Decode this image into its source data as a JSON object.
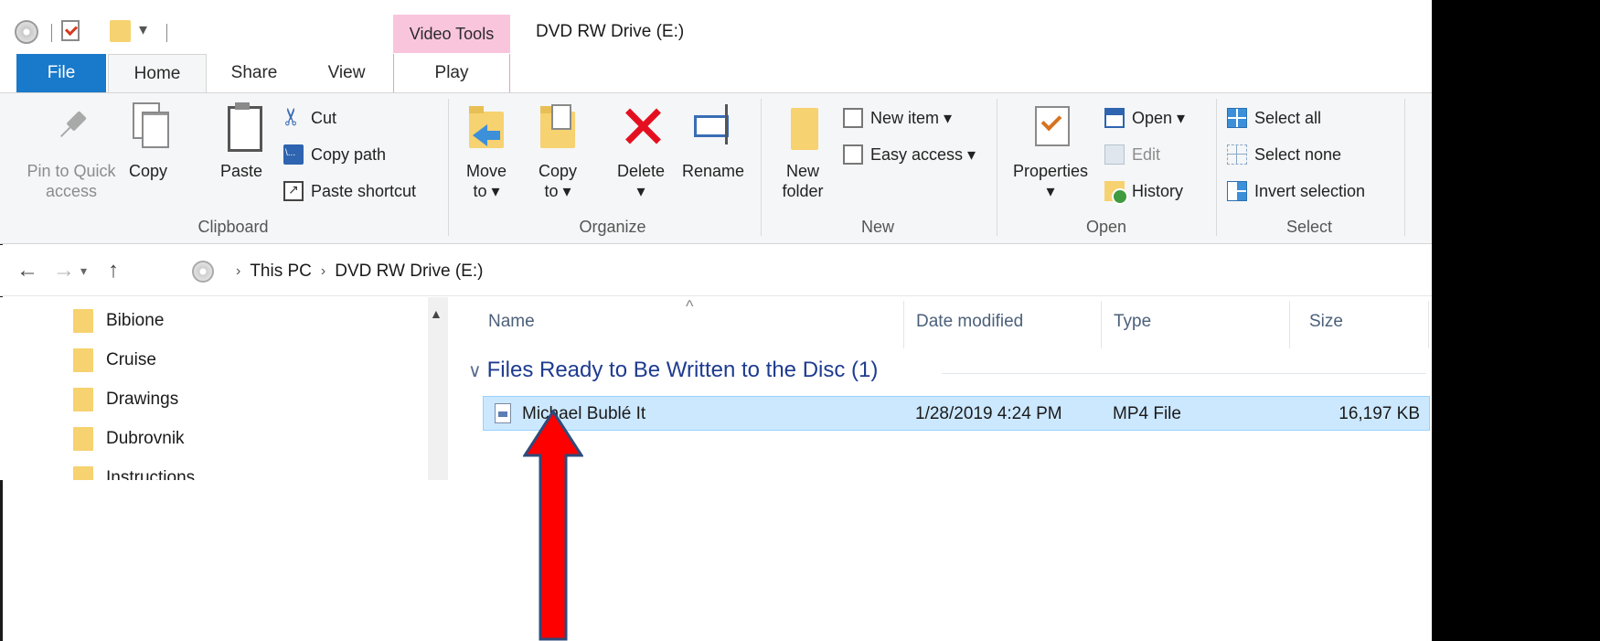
{
  "titlebar": {
    "contextual_tab": "Video Tools",
    "window_title": "DVD RW Drive (E:)"
  },
  "tabs": {
    "file": "File",
    "home": "Home",
    "share": "Share",
    "view": "View",
    "play": "Play"
  },
  "ribbon": {
    "clipboard": {
      "pin_label_1": "Pin to Quick",
      "pin_label_2": "access",
      "copy": "Copy",
      "paste": "Paste",
      "cut": "Cut",
      "copy_path": "Copy path",
      "paste_shortcut": "Paste shortcut",
      "group": "Clipboard"
    },
    "organize": {
      "move_to_1": "Move",
      "move_to_2": "to ▾",
      "copy_to_1": "Copy",
      "copy_to_2": "to ▾",
      "delete_1": "Delete",
      "delete_2": "▾",
      "rename": "Rename",
      "group": "Organize"
    },
    "new": {
      "new_folder_1": "New",
      "new_folder_2": "folder",
      "new_item": "New item ▾",
      "easy_access": "Easy access ▾",
      "group": "New"
    },
    "open": {
      "properties_1": "Properties",
      "properties_2": "▾",
      "open": "Open ▾",
      "edit": "Edit",
      "history": "History",
      "group": "Open"
    },
    "select": {
      "select_all": "Select all",
      "select_none": "Select none",
      "invert_selection": "Invert selection",
      "group": "Select"
    }
  },
  "address": {
    "crumbs": [
      "This PC",
      "DVD RW Drive (E:)"
    ],
    "sep": "›"
  },
  "navpane": {
    "items": [
      "Bibione",
      "Cruise",
      "Drawings",
      "Dubrovnik",
      "Instructions"
    ]
  },
  "filelist": {
    "columns": [
      "Name",
      "Date modified",
      "Type",
      "Size"
    ],
    "group_header": "Files Ready to Be Written to the Disc (1)",
    "files": [
      {
        "name": "Michael Bublé  It",
        "date": "1/28/2019 4:24 PM",
        "type": "MP4 File",
        "size": "16,197 KB"
      }
    ]
  },
  "colors": {
    "file_tab": "#1979ca",
    "video_tools": "#f9c5dd",
    "selection": "#cce8ff",
    "group_header": "#1e3b8f",
    "arrow_fill": "#ff0000",
    "arrow_stroke": "#2f4a7a"
  }
}
